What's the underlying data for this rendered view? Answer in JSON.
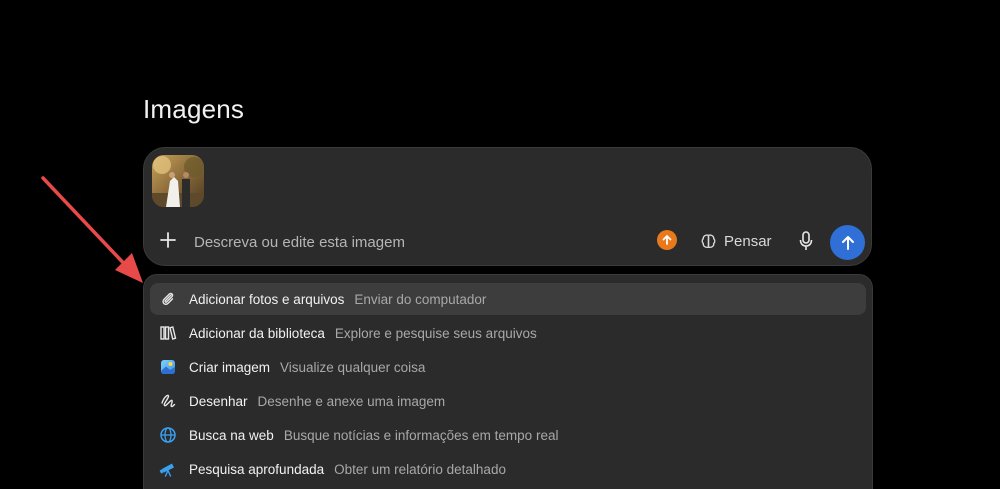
{
  "page": {
    "title": "Imagens"
  },
  "composer": {
    "attachment_thumbnail": "photo-thumbnail",
    "add_icon": "plus-icon",
    "placeholder": "Descreva ou edite esta imagem",
    "upgrade_icon": "arrow-up-circle-icon",
    "think_label": "Pensar",
    "think_icon": "brain-icon",
    "mic_icon": "microphone-icon",
    "send_icon": "arrow-up-icon"
  },
  "menu": {
    "items": [
      {
        "icon": "paperclip-icon",
        "label": "Adicionar fotos e arquivos",
        "desc": "Enviar do computador"
      },
      {
        "icon": "library-icon",
        "label": "Adicionar da biblioteca",
        "desc": "Explore e pesquise seus arquivos"
      },
      {
        "icon": "image-create-icon",
        "label": "Criar imagem",
        "desc": "Visualize qualquer coisa"
      },
      {
        "icon": "scribble-icon",
        "label": "Desenhar",
        "desc": "Desenhe e anexe uma imagem"
      },
      {
        "icon": "globe-icon",
        "label": "Busca na web",
        "desc": "Busque notícias e informações em tempo real"
      },
      {
        "icon": "telescope-icon",
        "label": "Pesquisa aprofundada",
        "desc": "Obter um relatório detalhado"
      }
    ]
  },
  "colors": {
    "background": "#000000",
    "panel": "#2b2b2b",
    "accent_send": "#2f6fd6",
    "accent_upgrade": "#e8791d",
    "annotation_arrow": "#e84a4a"
  }
}
